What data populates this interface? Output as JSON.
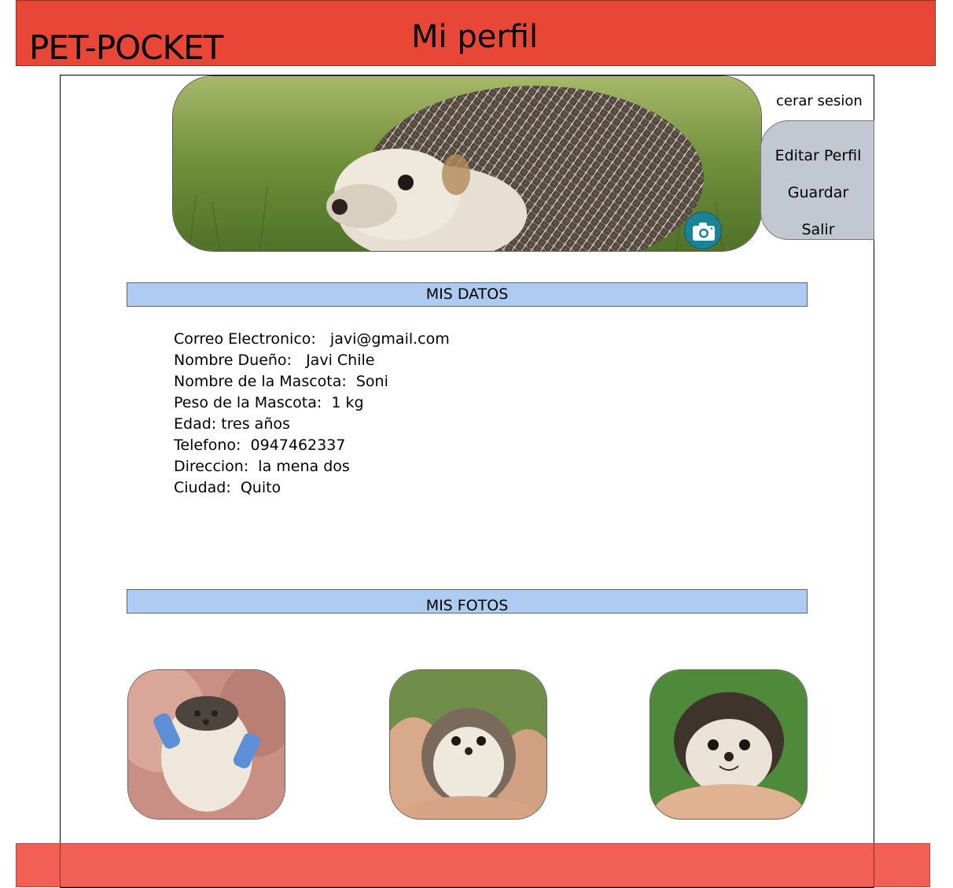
{
  "header": {
    "brand": "PET-POCKET",
    "title": "Mi perfil"
  },
  "profile": {
    "banner_icon": "hedgehog-banner-photo",
    "camera_icon": "camera-icon"
  },
  "account_menu": {
    "logout_label": "cerar sesion",
    "edit_label": "Editar Perfil",
    "save_label": "Guardar",
    "exit_label": "Salir"
  },
  "sections": {
    "data_title": "MIS DATOS",
    "photos_title": "MIS FOTOS"
  },
  "details": [
    {
      "text": "Correo Electronico:   javi@gmail.com"
    },
    {
      "text": "Nombre Dueño:   Javi Chile"
    },
    {
      "text": "Nombre de la Mascota:  Soni"
    },
    {
      "text": "Peso de la Mascota:  1 kg"
    },
    {
      "text": "Edad: tres años"
    },
    {
      "text": "Telefono:  0947462337"
    },
    {
      "text": "Direccion:  la mena dos"
    },
    {
      "text": "Ciudad:  Quito"
    }
  ],
  "photos": [
    {
      "icon": "hedgehog-photo-1"
    },
    {
      "icon": "hedgehog-photo-2"
    },
    {
      "icon": "hedgehog-photo-3"
    }
  ],
  "colors": {
    "header": "#e84637",
    "footer": "#f25f55",
    "section_bar": "#aecbf2",
    "menu_box": "#c2c8d1",
    "camera_button": "#1c8299"
  }
}
